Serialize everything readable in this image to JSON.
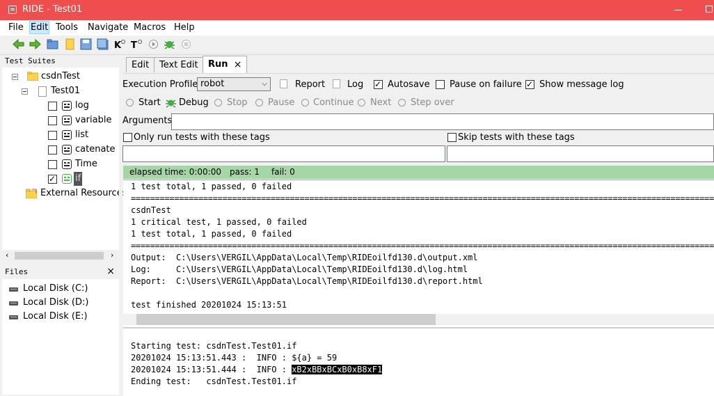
{
  "window": {
    "title": "RIDE - Test01"
  },
  "menubar": [
    "File",
    "Edit",
    "Tools",
    "Navigate",
    "Macros",
    "Help"
  ],
  "test_suites": {
    "title": "Test Suites",
    "suite": "csdnTest",
    "test": "Test01",
    "keywords": [
      {
        "label": "log",
        "checked": false
      },
      {
        "label": "variable",
        "checked": false
      },
      {
        "label": "list",
        "checked": false
      },
      {
        "label": "catenate",
        "checked": false
      },
      {
        "label": "Time",
        "checked": false
      },
      {
        "label": "if",
        "checked": true
      }
    ],
    "external": "External Resources"
  },
  "files": {
    "title": "Files",
    "close": "×",
    "drives": [
      "Local Disk (C:)",
      "Local Disk (D:)",
      "Local Disk (E:)"
    ]
  },
  "tabs": [
    "Edit",
    "Text Edit",
    "Run"
  ],
  "tab_close": "×",
  "run": {
    "profile_label": "Execution Profile:",
    "profile_value": "robot",
    "report": "Report",
    "log": "Log",
    "autosave": "Autosave",
    "autosave_checked": true,
    "pause_on_failure": "Pause on failure",
    "pause_checked": false,
    "show_message_log": "Show message log",
    "show_checked": true,
    "buttons": [
      "Start",
      "Debug",
      "Stop",
      "Pause",
      "Continue",
      "Next",
      "Step over"
    ],
    "arguments_label": "Arguments:",
    "only_run_tags": "Only run tests with these tags",
    "skip_tags": "Skip tests with these tags"
  },
  "status": {
    "elapsed": "elapsed time: 0:00:00",
    "pass": "pass: 1",
    "fail": "fail: 0"
  },
  "console_lines": [
    "1 test total, 1 passed, 0 failed",
    "==============================================================================================================================",
    "csdnTest",
    "1 critical test, 1 passed, 0 failed",
    "1 test total, 1 passed, 0 failed",
    "==============================================================================================================================",
    "Output:  C:\\Users\\VERGIL\\AppData\\Local\\Temp\\RIDEoilfd130.d\\output.xml",
    "Log:     C:\\Users\\VERGIL\\AppData\\Local\\Temp\\RIDEoilfd130.d\\log.html",
    "Report:  C:\\Users\\VERGIL\\AppData\\Local\\Temp\\RIDEoilfd130.d\\report.html",
    "",
    "test finished 20201024 15:13:51"
  ],
  "message_log": {
    "line1": "Starting test: csdnTest.Test01.if",
    "line2": "20201024 15:13:51.443 :  INFO : ${a} = 59",
    "line3_prefix": "20201024 15:13:51.444 :  INFO : ",
    "line3_highlight": "xB2xBBxBCxB0xB8xF1",
    "line4": "Ending test:   csdnTest.Test01.if"
  }
}
